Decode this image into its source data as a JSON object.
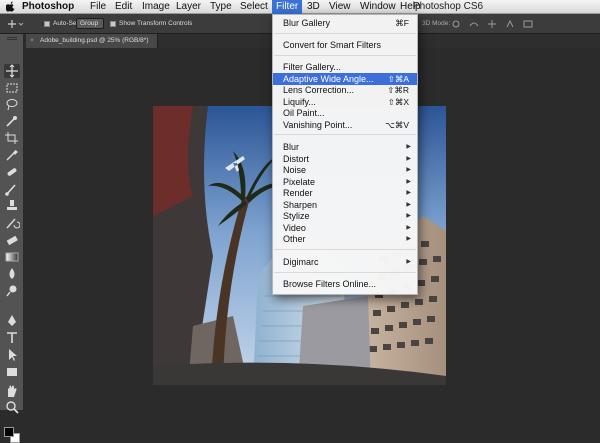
{
  "menubar": {
    "items": [
      "Photoshop",
      "File",
      "Edit",
      "Image",
      "Layer",
      "Type",
      "Select",
      "Filter",
      "3D",
      "View",
      "Window",
      "Help"
    ],
    "active_item": "Filter",
    "app_title": "Photoshop CS6"
  },
  "options_bar": {
    "auto_select_label": "Auto-Select:",
    "auto_select_value": "Group",
    "show_transform_label": "Show Transform Controls",
    "mode_3d_label": "3D Mode:"
  },
  "document_tab": {
    "title": "Adobe_building.psd @ 25% (RGB/8*)",
    "close_glyph": "×"
  },
  "filter_menu": {
    "items": [
      {
        "label": "Blur Gallery",
        "shortcut": "⌘F"
      },
      {
        "label": "Convert for Smart Filters",
        "shortcut": ""
      },
      {
        "label": "Filter Gallery...",
        "shortcut": ""
      },
      {
        "label": "Adaptive Wide Angle...",
        "shortcut": "⇧⌘A",
        "highlighted": true
      },
      {
        "label": "Lens Correction...",
        "shortcut": "⇧⌘R"
      },
      {
        "label": "Liquify...",
        "shortcut": "⇧⌘X"
      },
      {
        "label": "Oil Paint...",
        "shortcut": ""
      },
      {
        "label": "Vanishing Point...",
        "shortcut": "⌥⌘V"
      },
      {
        "label": "Blur",
        "submenu": true
      },
      {
        "label": "Distort",
        "submenu": true
      },
      {
        "label": "Noise",
        "submenu": true
      },
      {
        "label": "Pixelate",
        "submenu": true
      },
      {
        "label": "Render",
        "submenu": true
      },
      {
        "label": "Sharpen",
        "submenu": true
      },
      {
        "label": "Stylize",
        "submenu": true
      },
      {
        "label": "Video",
        "submenu": true
      },
      {
        "label": "Other",
        "submenu": true
      },
      {
        "label": "Digimarc",
        "submenu": true
      },
      {
        "label": "Browse Filters Online...",
        "shortcut": ""
      }
    ],
    "submenu_arrow": "▶",
    "highlight_color": "#3d6fdb"
  },
  "toolbar": {
    "tools": [
      "move-tool",
      "marquee-tool",
      "lasso-tool",
      "quick-select-tool",
      "crop-tool",
      "eyedropper-tool",
      "healing-tool",
      "brush-tool",
      "clone-stamp-tool",
      "history-brush-tool",
      "eraser-tool",
      "gradient-tool",
      "blur-tool",
      "dodge-tool",
      "pen-tool",
      "type-tool",
      "path-select-tool",
      "shape-tool",
      "hand-tool",
      "zoom-tool"
    ],
    "foreground_color": "#000000",
    "background_color": "#ffffff"
  }
}
